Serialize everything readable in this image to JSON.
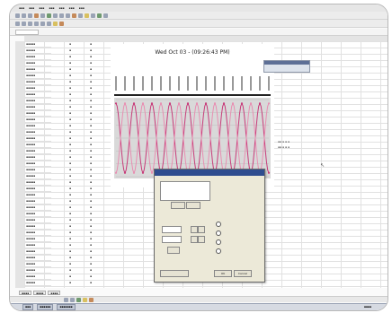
{
  "chart": {
    "title": "Wed Oct 03 - (09:26:43 PM)"
  },
  "dialog": {
    "buttons": [
      "OK",
      "Cancel",
      "Help"
    ]
  },
  "chart_data": {
    "type": "line",
    "title": "Wed Oct 03 - (09:26:43 PM)",
    "xlabel": "",
    "ylabel": "",
    "series": [
      {
        "name": "",
        "color": "#c83c7a",
        "values": [
          0.9,
          -0.9,
          0.9,
          -0.9,
          0.9,
          -0.9,
          0.9,
          -0.9,
          0.9,
          -0.9,
          0.9,
          -0.9,
          0.9,
          -0.9,
          0.9,
          -0.9,
          0.9,
          -0.9
        ]
      },
      {
        "name": "",
        "color": "#e88fb2",
        "values": [
          -0.9,
          0.9,
          -0.9,
          0.9,
          -0.9,
          0.9,
          -0.9,
          0.9,
          -0.9,
          0.9,
          -0.9,
          0.9,
          -0.9,
          0.9,
          -0.9,
          0.9,
          -0.9,
          0.9
        ]
      }
    ],
    "grid": true
  }
}
